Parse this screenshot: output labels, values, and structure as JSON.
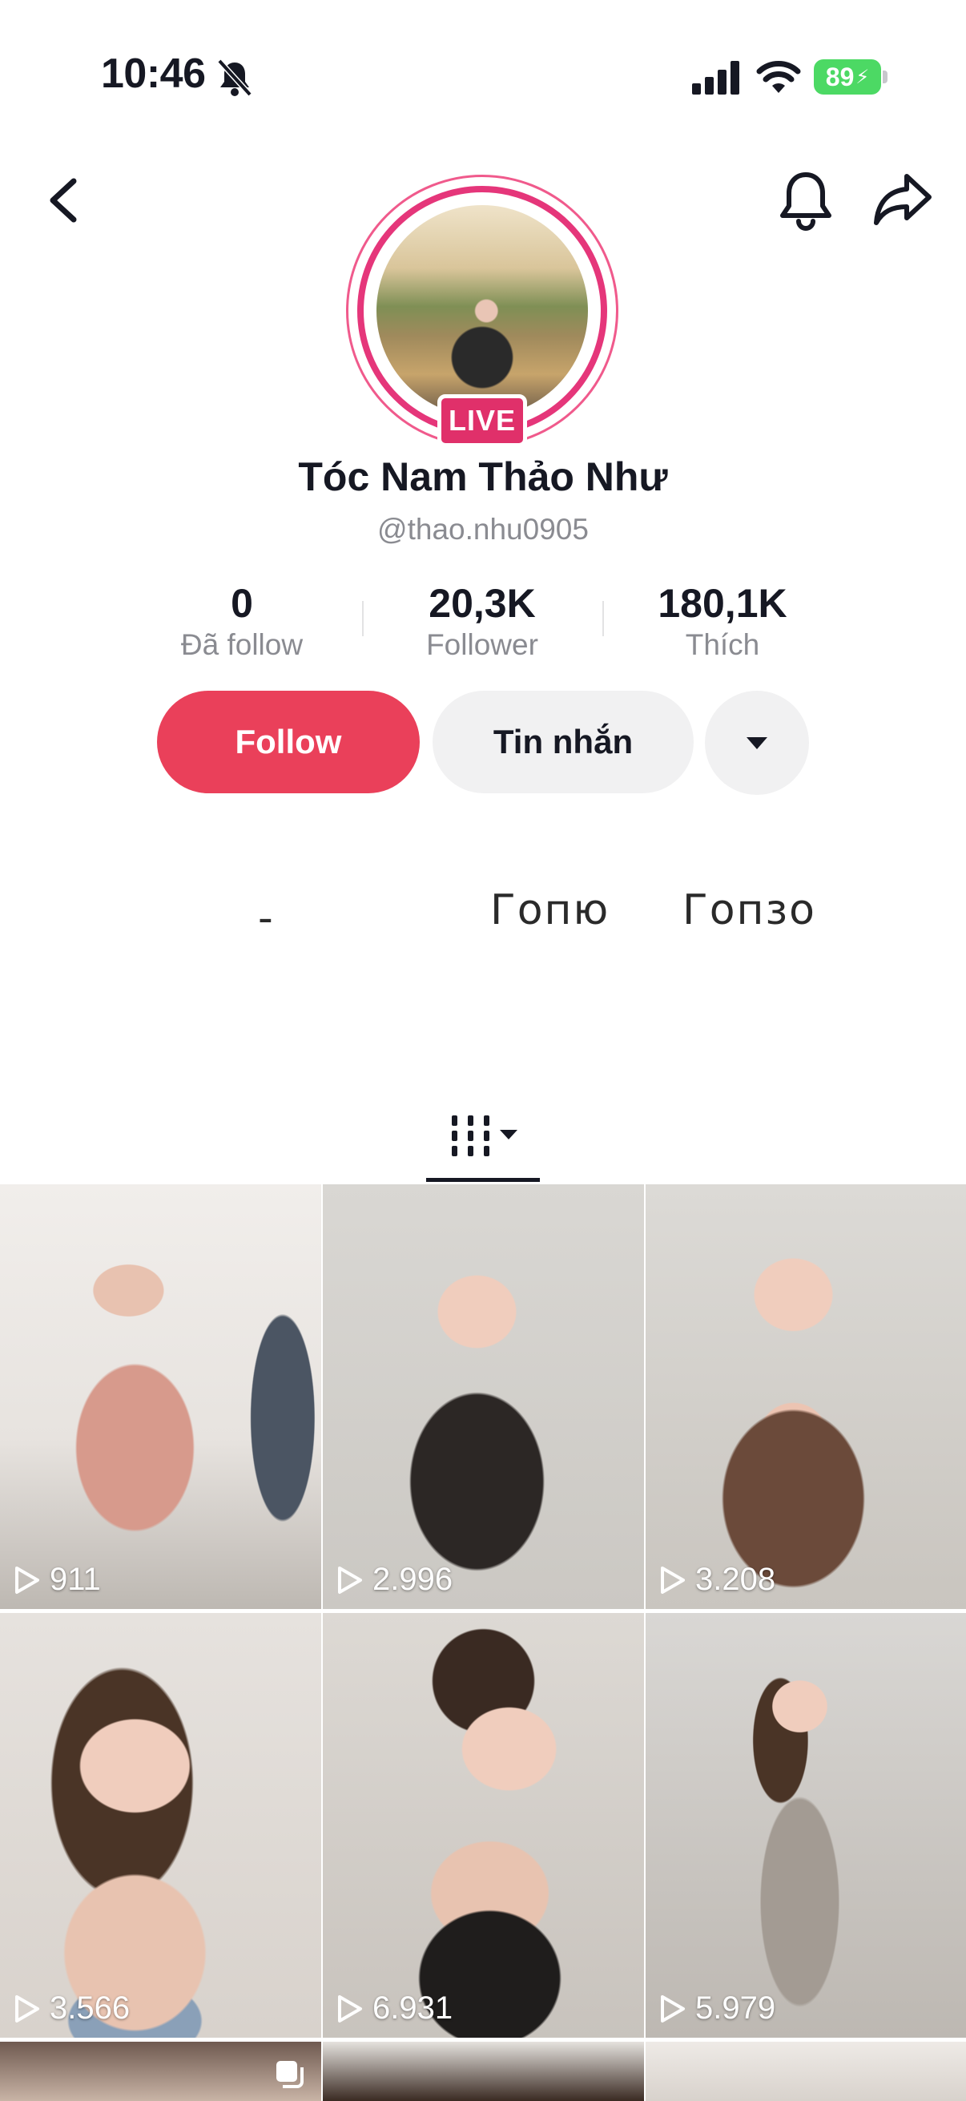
{
  "status_bar": {
    "time": "10:46",
    "battery": "89"
  },
  "header": {
    "back_icon": "chevron-left-icon",
    "notify_icon": "bell-icon",
    "share_icon": "share-arrow-icon"
  },
  "profile": {
    "live_badge": "LIVE",
    "name": "Tóc Nam Thảo Như",
    "handle": "@thao.nhu0905",
    "stats": [
      {
        "value": "0",
        "label": "Đã follow"
      },
      {
        "value": "20,3K",
        "label": "Follower"
      },
      {
        "value": "180,1K",
        "label": "Thích"
      }
    ]
  },
  "actions": {
    "follow_label": "Follow",
    "message_label": "Tin nhắn",
    "more_icon": "caret-down-icon"
  },
  "bio_fragments": [
    "-",
    "Гопю",
    "Гопзо"
  ],
  "colors": {
    "accent": "#ea405a",
    "live": "#e0306a",
    "muted_text": "#8a8b91"
  },
  "videos": [
    {
      "views": "911"
    },
    {
      "views": "2.996"
    },
    {
      "views": "3.208"
    },
    {
      "views": "3.566"
    },
    {
      "views": "6.931"
    },
    {
      "views": "5.979"
    }
  ]
}
